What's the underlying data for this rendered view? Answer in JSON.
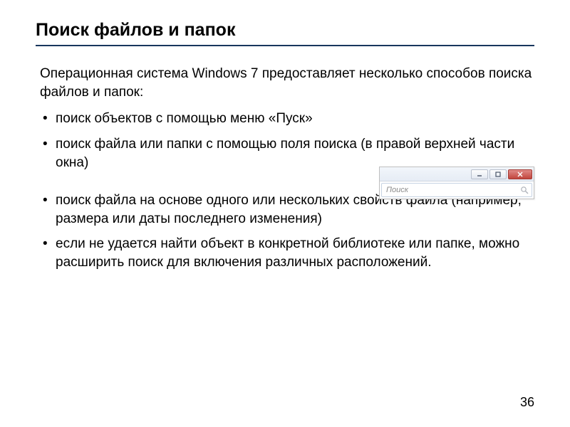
{
  "title": "Поиск файлов и папок",
  "lead": "Операционная система Windows 7 предоставляет несколько способов поиска файлов и папок:",
  "bullets": [
    "поиск объектов с помощью меню «Пуск»",
    "поиск файла или папки с помощью поля поиска (в правой верхней части окна)",
    "поиск файла на основе одного или нескольких свойств файла (например, размера или даты последнего изменения)",
    "если не удается найти объект в конкретной библиотеке или папке, можно расширить поиск для включения различных расположений."
  ],
  "search_widget": {
    "placeholder": "Поиск"
  },
  "page_number": "36"
}
